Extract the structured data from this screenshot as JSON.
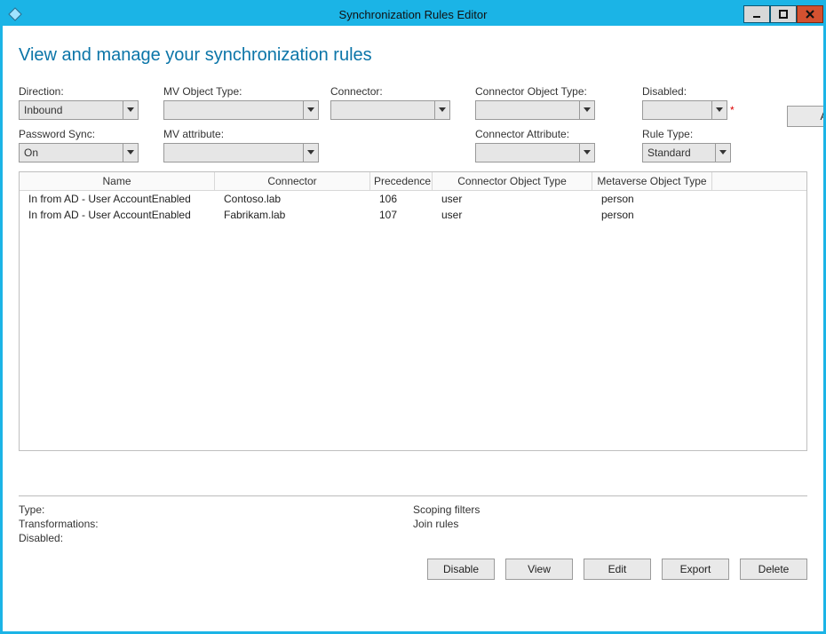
{
  "window": {
    "title": "Synchronization Rules Editor"
  },
  "page_title": "View and manage your synchronization rules",
  "filters": {
    "direction": {
      "label": "Direction:",
      "value": "Inbound"
    },
    "mv_object_type": {
      "label": "MV Object Type:",
      "value": ""
    },
    "connector": {
      "label": "Connector:",
      "value": ""
    },
    "connector_object_type": {
      "label": "Connector Object Type:",
      "value": ""
    },
    "disabled": {
      "label": "Disabled:",
      "value": ""
    },
    "password_sync": {
      "label": "Password Sync:",
      "value": "On"
    },
    "mv_attribute": {
      "label": "MV attribute:",
      "value": ""
    },
    "connector_attribute": {
      "label": "Connector Attribute:",
      "value": ""
    },
    "rule_type": {
      "label": "Rule Type:",
      "value": "Standard"
    }
  },
  "add_button_label": "Add new rule",
  "columns": {
    "name": "Name",
    "connector": "Connector",
    "precedence": "Precedence",
    "connector_object_type": "Connector Object Type",
    "metaverse_object_type": "Metaverse Object Type"
  },
  "rows": [
    {
      "name": "In from AD - User AccountEnabled",
      "connector": "Contoso.lab",
      "precedence": "106",
      "cotype": "user",
      "motype": "person"
    },
    {
      "name": "In from AD - User AccountEnabled",
      "connector": "Fabrikam.lab",
      "precedence": "107",
      "cotype": "user",
      "motype": "person"
    }
  ],
  "details": {
    "type_label": "Type:",
    "transformations_label": "Transformations:",
    "disabled_label": "Disabled:",
    "scoping_filters_label": "Scoping filters",
    "join_rules_label": "Join rules"
  },
  "actions": {
    "disable": "Disable",
    "view": "View",
    "edit": "Edit",
    "export": "Export",
    "delete": "Delete"
  },
  "required_asterisk": "*"
}
